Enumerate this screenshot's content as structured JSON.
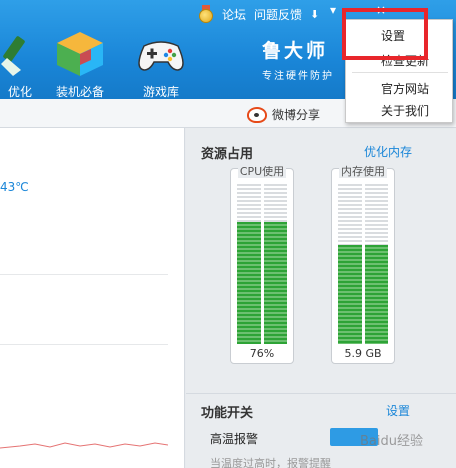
{
  "header": {
    "links": [
      "论坛",
      "问题反馈"
    ],
    "win_controls": [
      "▾",
      "–",
      "×"
    ],
    "brand_name": "鲁大师",
    "brand_slogan": "专注硬件防护",
    "nav": [
      {
        "label": "优化"
      },
      {
        "label": "装机必备"
      },
      {
        "label": "游戏库"
      }
    ]
  },
  "subbar": {
    "share_label": "微博分享"
  },
  "left": {
    "temperature_text": "43℃"
  },
  "resources": {
    "title": "资源占用",
    "optimize_link": "优化内存",
    "cpu": {
      "label": "CPU使用",
      "value_text": "76%",
      "level": 0.76
    },
    "memory": {
      "label": "内存使用",
      "value_text": "5.9 GB",
      "level": 0.62
    }
  },
  "functions": {
    "title": "功能开关",
    "settings_link": "设置",
    "item": "高温报警",
    "desc": "当温度过高时，报警提醒"
  },
  "dropdown": {
    "items": [
      "设置",
      "检查更新",
      "官方网站",
      "关于我们"
    ]
  },
  "watermark": "Baidu经验",
  "colors": {
    "accent": "#1a86d8",
    "gauge_fill": "#2da336",
    "highlight": "#e8262b"
  }
}
